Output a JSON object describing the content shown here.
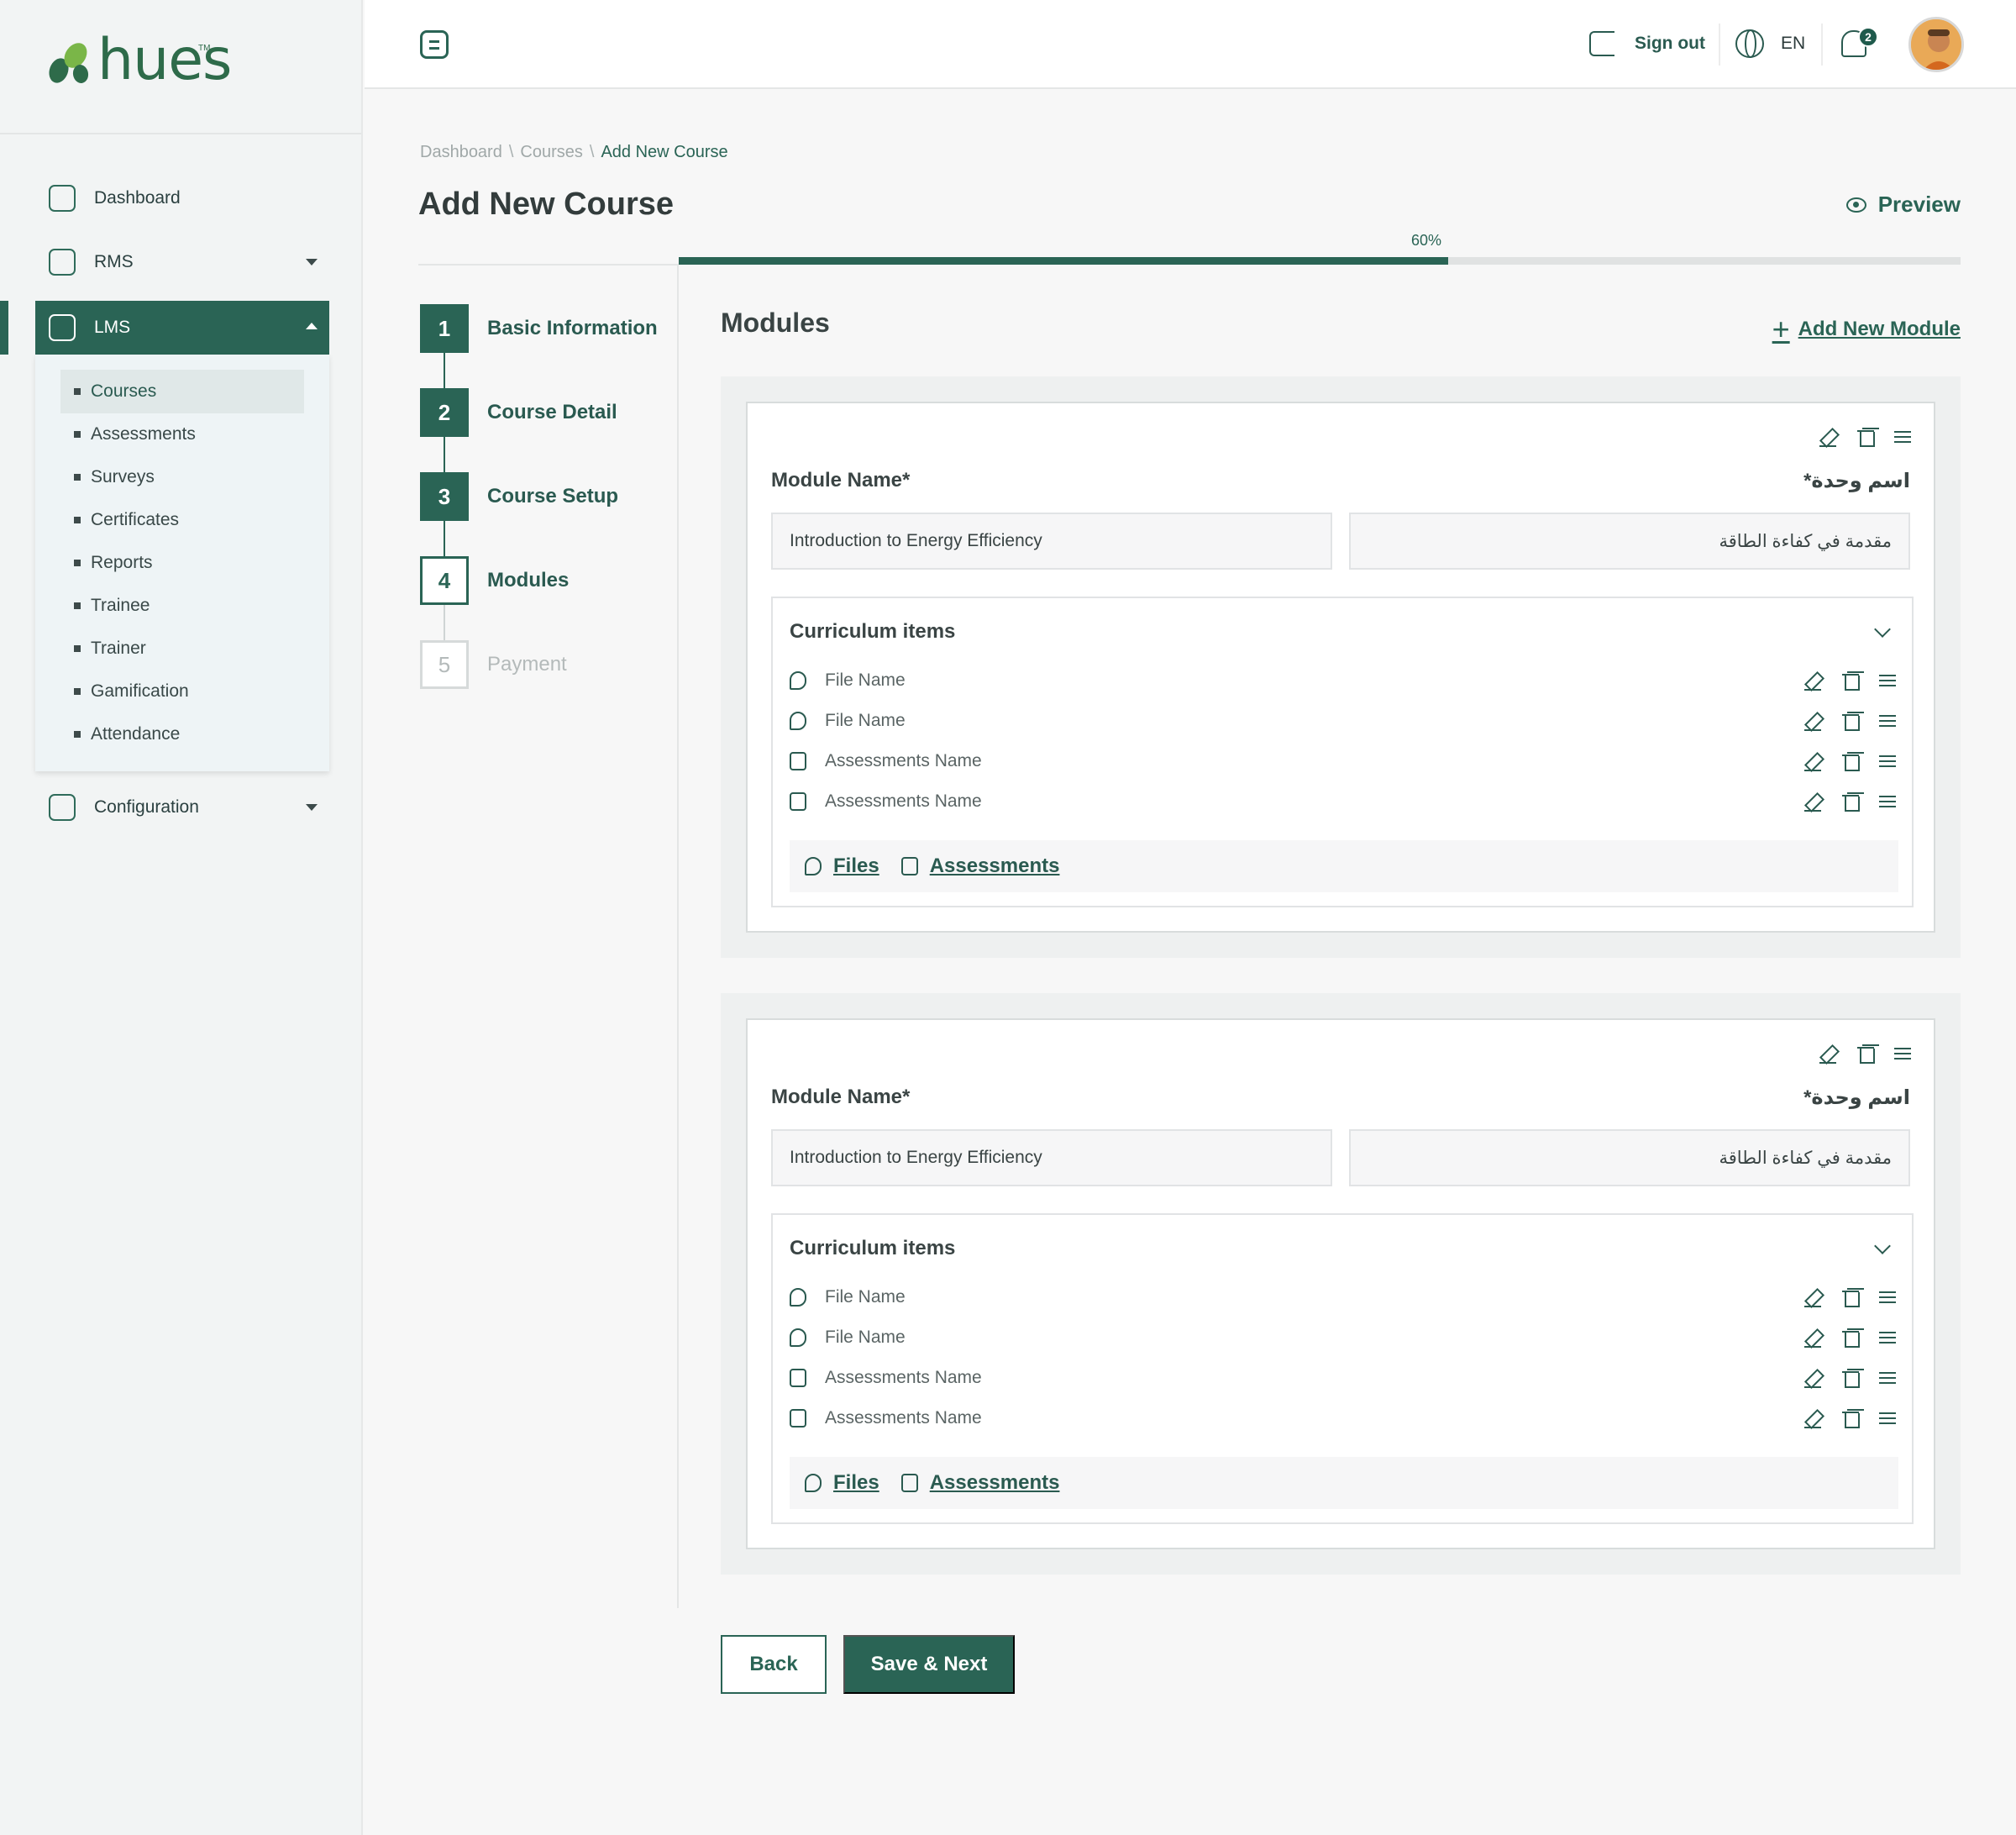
{
  "brand": {
    "name": "hues",
    "tm": "TM",
    "colors": {
      "primary": "#2a6455",
      "logo_leaf_dark": "#2e6b4a",
      "logo_leaf_light": "#7ab648"
    }
  },
  "sidebar": {
    "items": [
      {
        "label": "Dashboard",
        "icon": "dashboard-icon"
      },
      {
        "label": "RMS",
        "icon": "rms-icon"
      },
      {
        "label": "LMS",
        "icon": "lms-icon"
      },
      {
        "label": "Configuration",
        "icon": "configuration-icon"
      }
    ],
    "lms_submenu": [
      "Courses",
      "Assessments",
      "Surveys",
      "Certificates",
      "Reports",
      "Trainee",
      "Trainer",
      "Gamification",
      "Attendance"
    ]
  },
  "header": {
    "sign_out": "Sign out",
    "language": "EN",
    "notification_count": "2"
  },
  "breadcrumb": [
    "Dashboard",
    "Courses",
    "Add New Course"
  ],
  "page": {
    "title": "Add New Course",
    "preview": "Preview",
    "progress_label": "60%",
    "progress": 0.6
  },
  "steps": [
    {
      "num": "1",
      "label": "Basic Information",
      "state": "done"
    },
    {
      "num": "2",
      "label": "Course Detail",
      "state": "done"
    },
    {
      "num": "3",
      "label": "Course Setup",
      "state": "done"
    },
    {
      "num": "4",
      "label": "Modules",
      "state": "current"
    },
    {
      "num": "5",
      "label": "Payment",
      "state": "future"
    }
  ],
  "modules_section": {
    "title": "Modules",
    "add_label": "Add New Module",
    "modules": [
      {
        "name_label_en": "Module Name*",
        "name_label_ar": "اسم وحدة*",
        "name_en": "Introduction to Energy Efficiency",
        "name_ar": "مقدمة في كفاءة الطاقة",
        "curriculum_title": "Curriculum items",
        "items": [
          "File Name",
          "File Name",
          "Assessments Name",
          "Assessments Name"
        ],
        "footer_files": "Files",
        "footer_assessments": "Assessments"
      },
      {
        "name_label_en": "Module Name*",
        "name_label_ar": "اسم وحدة*",
        "name_en": "Introduction to Energy Efficiency",
        "name_ar": "مقدمة في كفاءة الطاقة",
        "curriculum_title": "Curriculum items",
        "items": [
          "File Name",
          "File Name",
          "Assessments Name",
          "Assessments Name"
        ],
        "footer_files": "Files",
        "footer_assessments": "Assessments"
      }
    ]
  },
  "actions": {
    "back": "Back",
    "save_next": "Save & Next"
  }
}
